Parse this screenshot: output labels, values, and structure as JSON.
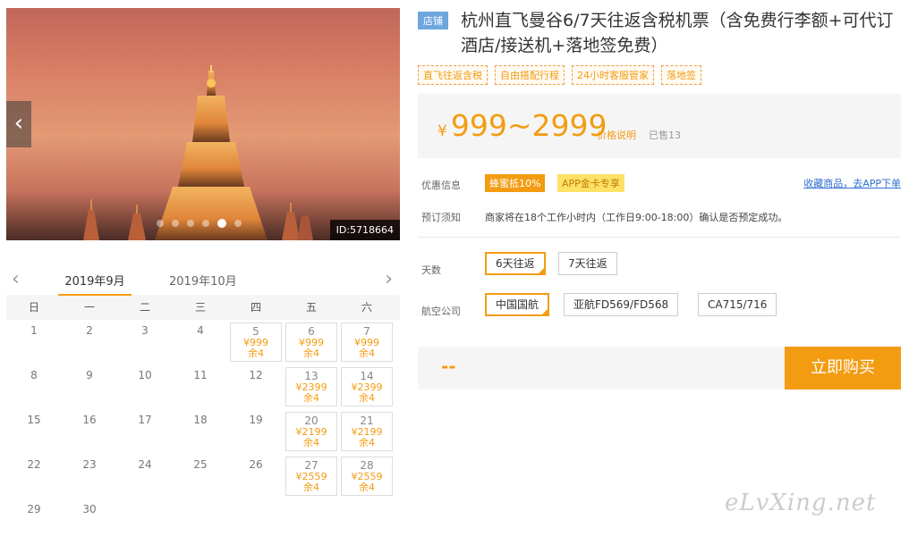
{
  "gallery": {
    "image_id": "ID:5718664",
    "dot_count": 6,
    "active_dot": 4
  },
  "calendar": {
    "months": [
      "2019年9月",
      "2019年10月"
    ],
    "weekdays": [
      "日",
      "一",
      "二",
      "三",
      "四",
      "五",
      "六"
    ],
    "first_day_offset": 0,
    "days": [
      {
        "day": "1"
      },
      {
        "day": "2"
      },
      {
        "day": "3"
      },
      {
        "day": "4"
      },
      {
        "day": "5",
        "price": "¥999",
        "stock": "余4"
      },
      {
        "day": "6",
        "price": "¥999",
        "stock": "余4"
      },
      {
        "day": "7",
        "price": "¥999",
        "stock": "余4"
      },
      {
        "day": "8"
      },
      {
        "day": "9"
      },
      {
        "day": "10"
      },
      {
        "day": "11"
      },
      {
        "day": "12"
      },
      {
        "day": "13",
        "price": "¥2399",
        "stock": "余4"
      },
      {
        "day": "14",
        "price": "¥2399",
        "stock": "余4"
      },
      {
        "day": "15"
      },
      {
        "day": "16"
      },
      {
        "day": "17"
      },
      {
        "day": "18"
      },
      {
        "day": "19"
      },
      {
        "day": "20",
        "price": "¥2199",
        "stock": "余4"
      },
      {
        "day": "21",
        "price": "¥2199",
        "stock": "余4"
      },
      {
        "day": "22"
      },
      {
        "day": "23"
      },
      {
        "day": "24"
      },
      {
        "day": "25"
      },
      {
        "day": "26"
      },
      {
        "day": "27",
        "price": "¥2559",
        "stock": "余4"
      },
      {
        "day": "28",
        "price": "¥2559",
        "stock": "余4"
      },
      {
        "day": "29"
      },
      {
        "day": "30"
      }
    ]
  },
  "product": {
    "shop_badge": "店铺",
    "title": "杭州直飞曼谷6/7天往返含税机票（含免费行李额+可代订酒店/接送机+落地签免费）",
    "tags": [
      "直飞往返含税",
      "自由搭配行程",
      "24小时客服管家",
      "落地签"
    ],
    "currency": "¥",
    "price": "999~2999",
    "price_note": "价格说明",
    "sold": "已售13"
  },
  "promo": {
    "label": "优惠信息",
    "badge1": "蜂蜜抵10%",
    "badge2": "APP金卡专享",
    "fav_link": "收藏商品，去APP下单"
  },
  "booking": {
    "label": "预订须知",
    "text": "商家将在18个工作小时内（工作日9:00-18:00）确认是否预定成功。"
  },
  "options": {
    "days_label": "天数",
    "days": [
      "6天往返",
      "7天往返"
    ],
    "airline_label": "航空公司",
    "airlines": [
      "中国国航",
      "亚航FD569/FD568",
      "CA715/716"
    ]
  },
  "purchase": {
    "total": "--",
    "buy_label": "立即购买"
  },
  "watermark": "eLvXing.net",
  "colors": {
    "accent": "#f39c12",
    "link": "#2f6fcf",
    "shop_badge": "#6ea6e0"
  }
}
